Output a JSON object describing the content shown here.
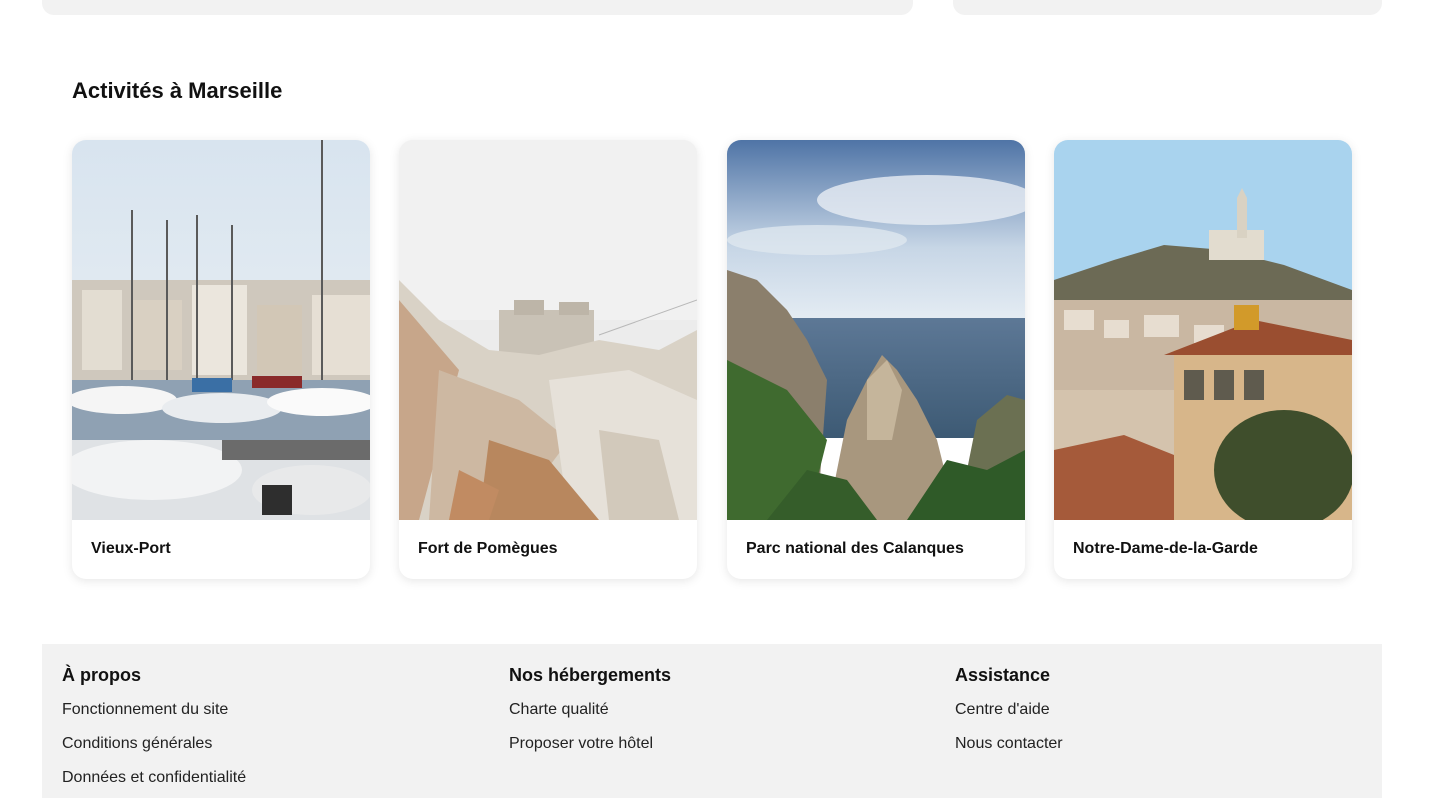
{
  "section": {
    "title": "Activités à Marseille"
  },
  "activities": [
    {
      "label": "Vieux-Port",
      "image": "harbor-with-sailboats"
    },
    {
      "label": "Fort de Pomègues",
      "image": "rocky-coast-with-fort"
    },
    {
      "label": "Parc national des Calanques",
      "image": "cliffs-and-sea"
    },
    {
      "label": "Notre-Dame-de-la-Garde",
      "image": "basilica-on-hill-over-city"
    }
  ],
  "footer": {
    "columns": [
      {
        "heading": "À propos",
        "links": [
          "Fonctionnement du site",
          "Conditions générales",
          "Données et confidentialité"
        ]
      },
      {
        "heading": "Nos hébergements",
        "links": [
          "Charte qualité",
          "Proposer votre hôtel"
        ]
      },
      {
        "heading": "Assistance",
        "links": [
          "Centre d'aide",
          "Nous contacter"
        ]
      }
    ]
  },
  "colors": {
    "footer_bg": "#f2f2f2",
    "text": "#111111"
  }
}
